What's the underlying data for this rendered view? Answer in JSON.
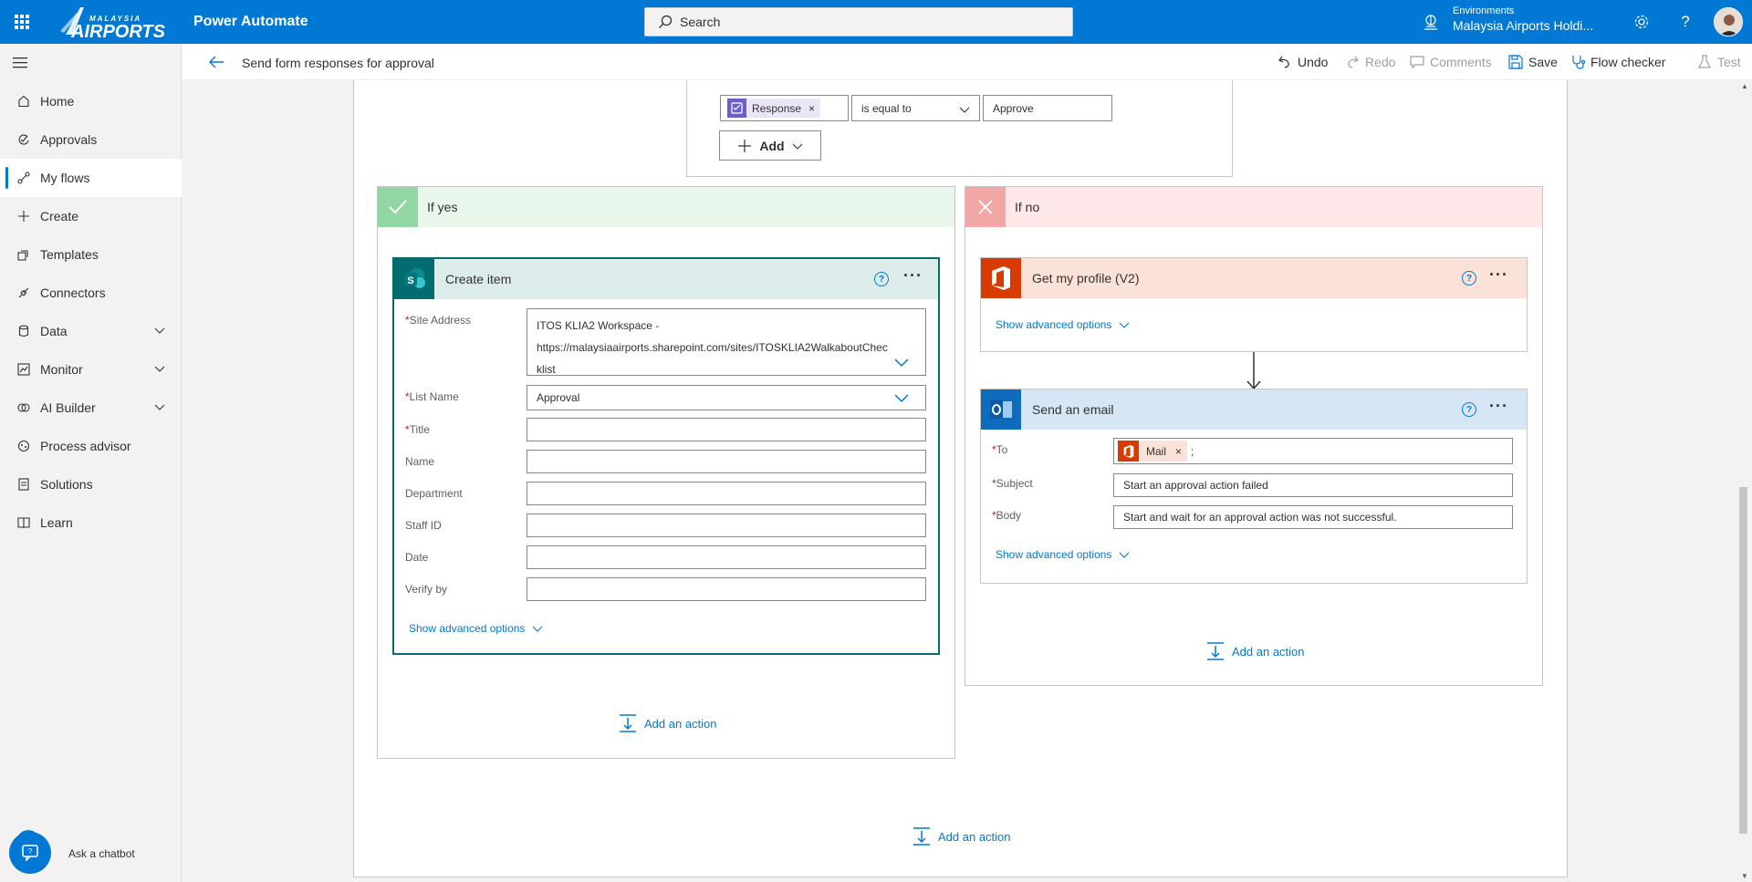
{
  "app": {
    "logo_top": "MALAYSIA",
    "logo_main": "AIRPORTS",
    "name": "Power Automate"
  },
  "search": {
    "placeholder": "Search"
  },
  "environment": {
    "label": "Environments",
    "name": "Malaysia Airports Holdi..."
  },
  "sidebar": {
    "items": [
      {
        "label": "Home",
        "icon": "home-icon"
      },
      {
        "label": "Approvals",
        "icon": "approvals-icon"
      },
      {
        "label": "My flows",
        "icon": "flows-icon",
        "active": true
      },
      {
        "label": "Create",
        "icon": "plus-icon"
      },
      {
        "label": "Templates",
        "icon": "templates-icon"
      },
      {
        "label": "Connectors",
        "icon": "connectors-icon"
      },
      {
        "label": "Data",
        "icon": "data-icon",
        "expandable": true
      },
      {
        "label": "Monitor",
        "icon": "monitor-icon",
        "expandable": true
      },
      {
        "label": "AI Builder",
        "icon": "ai-builder-icon",
        "expandable": true
      },
      {
        "label": "Process advisor",
        "icon": "process-advisor-icon"
      },
      {
        "label": "Solutions",
        "icon": "solutions-icon"
      },
      {
        "label": "Learn",
        "icon": "learn-icon"
      }
    ],
    "chatbot_label": "Ask a chatbot"
  },
  "commandbar": {
    "flow_title": "Send form responses for approval",
    "undo": "Undo",
    "redo": "Redo",
    "comments": "Comments",
    "save": "Save",
    "flow_checker": "Flow checker",
    "test": "Test"
  },
  "condition": {
    "token": "Response",
    "operator": "is equal to",
    "value": "Approve",
    "add_label": "Add"
  },
  "branch_yes": {
    "label": "If yes",
    "card": {
      "title": "Create item",
      "fields": {
        "site_address_label": "Site Address",
        "site_address_line1": "ITOS KLIA2 Workspace -",
        "site_address_line2": "https://malaysiaairports.sharepoint.com/sites/ITOSKLIA2WalkaboutChec",
        "site_address_line3": "klist",
        "list_name_label": "List Name",
        "list_name_value": "Approval",
        "title_label": "Title",
        "name_label": "Name",
        "department_label": "Department",
        "staff_id_label": "Staff ID",
        "date_label": "Date",
        "verify_by_label": "Verify by"
      },
      "advanced": "Show advanced options"
    },
    "add_action": "Add an action"
  },
  "branch_no": {
    "label": "If no",
    "profile_card": {
      "title": "Get my profile (V2)",
      "advanced": "Show advanced options"
    },
    "email_card": {
      "title": "Send an email",
      "to_label": "To",
      "to_token": "Mail",
      "to_separator": ";",
      "subject_label": "Subject",
      "subject_value": "Start an approval action failed",
      "body_label": "Body",
      "body_value": "Start and wait for an approval action was not successful.",
      "advanced": "Show advanced options"
    },
    "add_action": "Add an action"
  },
  "main_add_action": "Add an action",
  "colors": {
    "brand": "#0078d4",
    "yes_header": "#e9f6ec",
    "yes_icon": "#92d6a3",
    "no_header": "#fde7e9",
    "no_icon": "#f1a7a6",
    "sharepoint": "#036c70",
    "office": "#d83b01"
  }
}
